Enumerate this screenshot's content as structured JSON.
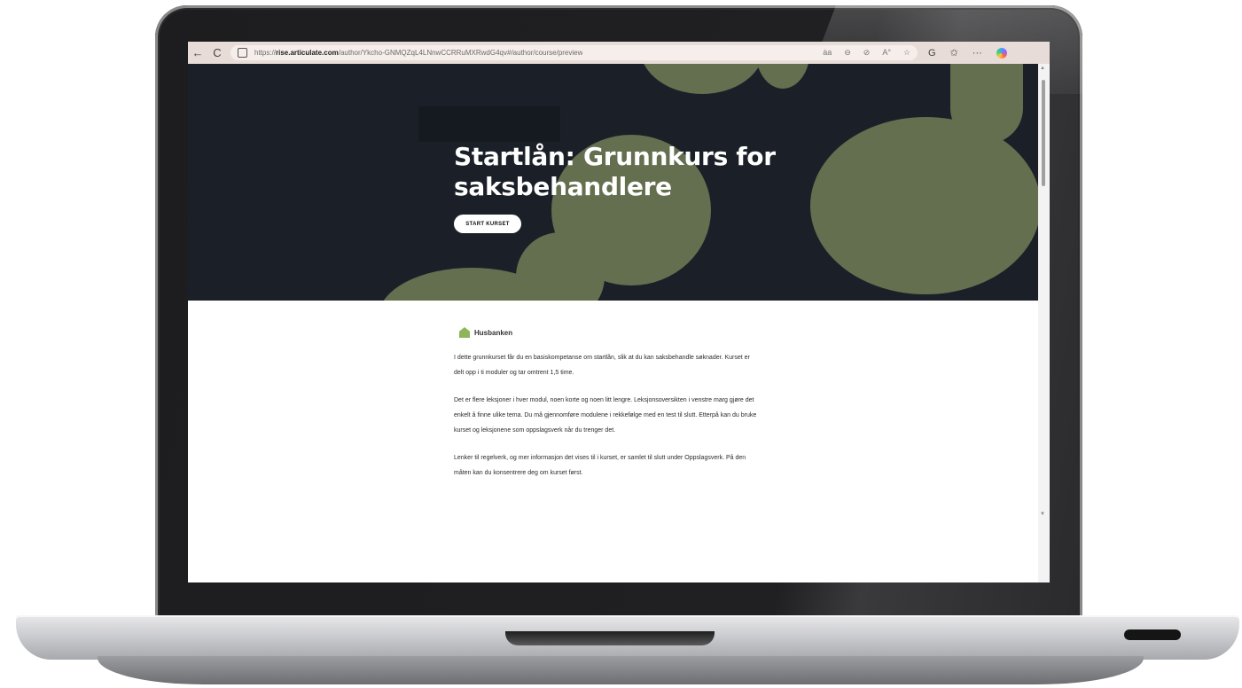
{
  "browser": {
    "url_prefix": "https://",
    "url_host": "rise.articulate.com",
    "url_path": "/author/Ykcho-GNMQZqL4LNnwCCRRuMXRwdG4qv#/author/course/preview",
    "back_icon": "←",
    "refresh_icon": "C",
    "toolbar_icons": [
      "aa-icon",
      "zoom-icon",
      "hide-icon",
      "read-aloud-icon",
      "favorite-icon",
      "extensions-icon",
      "favorites-icon",
      "more-icon",
      "copilot-icon"
    ]
  },
  "hero": {
    "title": "Startlån: Grunnkurs for saksbehandlere",
    "start_button": "START KURSET",
    "background_color": "#1b2028",
    "blob_color": "#636f4f"
  },
  "body": {
    "logo_text": "Husbanken",
    "paragraphs": [
      "I dette grunnkurset får du en basiskompetanse om startlån, slik at du kan saksbehandle søknader. Kurset er delt opp i ti moduler og tar omtrent 1,5 time.",
      "Det er flere leksjoner i hver modul, noen korte og noen litt lengre. Leksjonsoversikten i venstre marg gjøre det enkelt å finne ulike tema. Du må gjennomføre modulene i rekkefølge med en test til slutt. Etterpå kan du bruke kurset og leksjonene som oppslagsverk når du trenger det.",
      "Lenker til regelverk, og mer informasjon det vises til i kurset, er samlet til slutt under Oppslagsverk. På den måten kan du konsentrere deg om kurset først."
    ]
  }
}
